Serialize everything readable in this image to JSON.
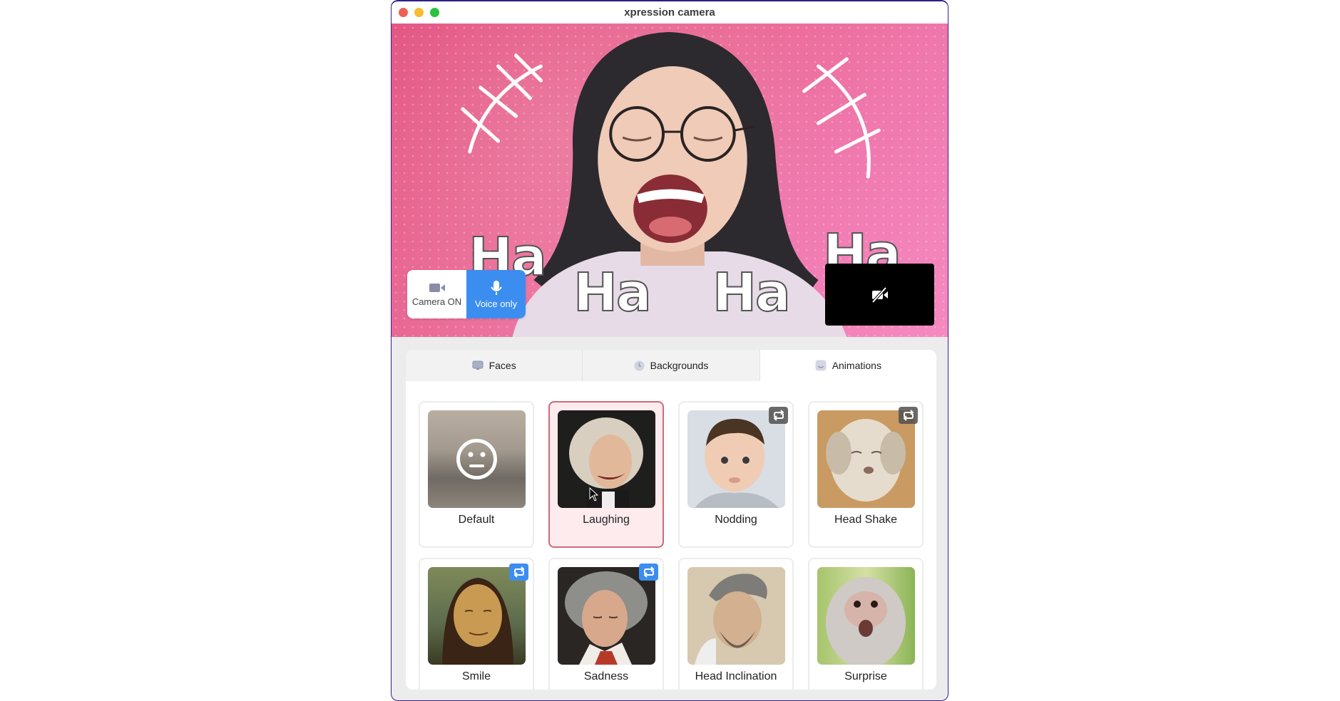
{
  "window": {
    "title": "xpression camera"
  },
  "video": {
    "overlay_texts": [
      "Ha",
      "Ha",
      "Ha",
      "Ha"
    ],
    "camera_toggle": {
      "options": [
        {
          "label": "Camera ON",
          "icon": "video-camera-icon",
          "active": false
        },
        {
          "label": "Voice only",
          "icon": "microphone-icon",
          "active": true
        }
      ]
    },
    "preview_status_icon": "camera-off-icon"
  },
  "tabs": [
    {
      "label": "Faces",
      "icon": "monitor-icon",
      "active": false
    },
    {
      "label": "Backgrounds",
      "icon": "clock-icon",
      "active": false
    },
    {
      "label": "Animations",
      "icon": "smile-icon",
      "active": true
    }
  ],
  "animations": [
    {
      "label": "Default",
      "loop": null,
      "selected": false
    },
    {
      "label": "Laughing",
      "loop": null,
      "selected": true
    },
    {
      "label": "Nodding",
      "loop": "gray",
      "selected": false
    },
    {
      "label": "Head Shake",
      "loop": "gray",
      "selected": false
    },
    {
      "label": "Smile",
      "loop": "blue",
      "selected": false
    },
    {
      "label": "Sadness",
      "loop": "blue",
      "selected": false
    },
    {
      "label": "Head Inclination",
      "loop": null,
      "selected": false
    },
    {
      "label": "Surprise",
      "loop": null,
      "selected": false
    }
  ],
  "colors": {
    "accent_blue": "#3b8ef0",
    "selected_border": "#d06a7a",
    "selected_bg": "#fdebee",
    "video_bg": "#e85a8a"
  }
}
